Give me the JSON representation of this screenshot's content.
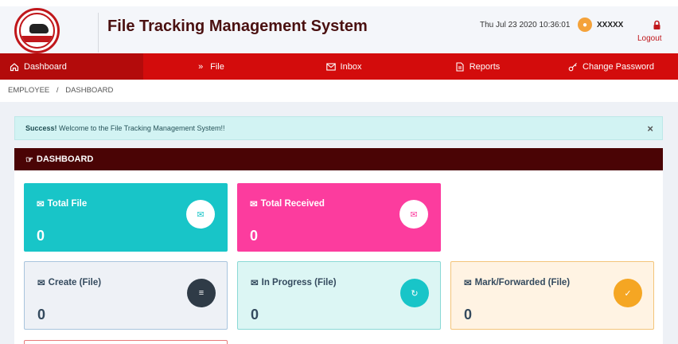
{
  "header": {
    "title": "File Tracking Management System",
    "datetime": "Thu Jul 23 2020 10:36:01",
    "username": "XXXXX",
    "logout_label": "Logout"
  },
  "nav": {
    "items": [
      {
        "label": "Dashboard",
        "icon": "home-icon"
      },
      {
        "label": "File",
        "icon": "chevrons-down-icon"
      },
      {
        "label": "Inbox",
        "icon": "envelope-icon"
      },
      {
        "label": "Reports",
        "icon": "document-icon"
      },
      {
        "label": "Change Password",
        "icon": "key-icon"
      }
    ]
  },
  "breadcrumb": {
    "items": [
      "EMPLOYEE",
      "/",
      "DASHBOARD"
    ]
  },
  "alert": {
    "strong": "Success!",
    "message": "Welcome to the File Tracking Management System!!",
    "close": "×"
  },
  "panel": {
    "title": "DASHBOARD"
  },
  "cards": [
    {
      "label": "Total File",
      "count": "0",
      "icon": "envelope-icon",
      "color": "#18c5c8"
    },
    {
      "label": "Total Received",
      "count": "0",
      "icon": "envelope-icon",
      "color": "#fc3c9e"
    },
    {
      "label": "Create (File)",
      "count": "0",
      "icon": "database-icon",
      "color": "#2f3b47"
    },
    {
      "label": "In Progress (File)",
      "count": "0",
      "icon": "refresh-icon",
      "color": "#18c5c8"
    },
    {
      "label": "Mark/Forwarded (File)",
      "count": "0",
      "icon": "check-icon",
      "color": "#f5a623"
    }
  ],
  "colors": {
    "brand_red": "#d30c0c",
    "panel_header": "#4a0405",
    "title": "#4a1010"
  }
}
